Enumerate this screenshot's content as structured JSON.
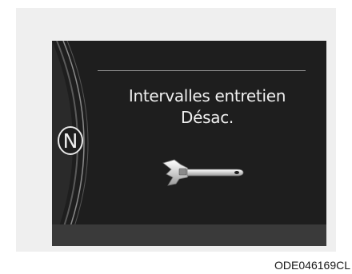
{
  "display": {
    "message_line_1": "Intervalles entretien",
    "message_line_2": "Désac.",
    "gear_indicator": "N",
    "icon": "wrench-icon"
  },
  "caption": "ODE046169CL",
  "colors": {
    "screen_background": "#1e1e1e",
    "text": "#f0f0f0",
    "panel_background": "#efefef"
  }
}
